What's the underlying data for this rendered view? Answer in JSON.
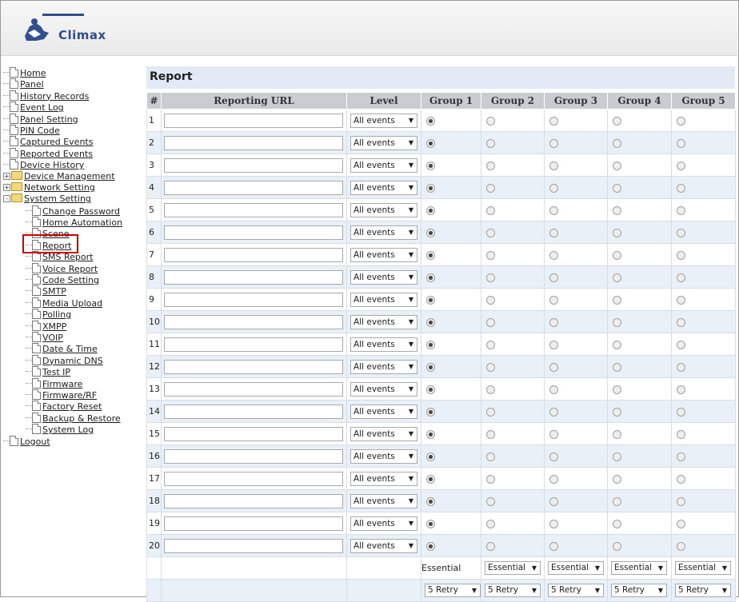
{
  "brand": {
    "name": "Climax"
  },
  "sidebar": {
    "items": [
      {
        "label": "Home",
        "kind": "doc",
        "level": 0
      },
      {
        "label": "Panel",
        "kind": "doc",
        "level": 0
      },
      {
        "label": "History Records",
        "kind": "doc",
        "level": 0
      },
      {
        "label": "Event Log",
        "kind": "doc",
        "level": 0
      },
      {
        "label": "Panel Setting",
        "kind": "doc",
        "level": 0
      },
      {
        "label": "PIN Code",
        "kind": "doc",
        "level": 0
      },
      {
        "label": "Captured Events",
        "kind": "doc",
        "level": 0
      },
      {
        "label": "Reported Events",
        "kind": "doc",
        "level": 0
      },
      {
        "label": "Device History",
        "kind": "doc",
        "level": 0
      },
      {
        "label": "Device Management",
        "kind": "folder",
        "level": 0,
        "expander": "+"
      },
      {
        "label": "Network Setting",
        "kind": "folder",
        "level": 0,
        "expander": "+"
      },
      {
        "label": "System Setting",
        "kind": "folder",
        "level": 0,
        "expander": "-"
      },
      {
        "label": "Change Password",
        "kind": "doc",
        "level": 1
      },
      {
        "label": "Home Automation",
        "kind": "doc",
        "level": 1
      },
      {
        "label": "Scene",
        "kind": "doc",
        "level": 1
      },
      {
        "label": "Report",
        "kind": "doc",
        "level": 1
      },
      {
        "label": "SMS Report",
        "kind": "doc",
        "level": 1
      },
      {
        "label": "Voice Report",
        "kind": "doc",
        "level": 1
      },
      {
        "label": "Code Setting",
        "kind": "doc",
        "level": 1
      },
      {
        "label": "SMTP",
        "kind": "doc",
        "level": 1
      },
      {
        "label": "Media Upload",
        "kind": "doc",
        "level": 1
      },
      {
        "label": "Polling",
        "kind": "doc",
        "level": 1
      },
      {
        "label": "XMPP",
        "kind": "doc",
        "level": 1
      },
      {
        "label": "VOIP",
        "kind": "doc",
        "level": 1
      },
      {
        "label": "Date & Time",
        "kind": "doc",
        "level": 1
      },
      {
        "label": "Dynamic DNS",
        "kind": "doc",
        "level": 1
      },
      {
        "label": "Test IP",
        "kind": "doc",
        "level": 1
      },
      {
        "label": "Firmware",
        "kind": "doc",
        "level": 1
      },
      {
        "label": "Firmware/RF",
        "kind": "doc",
        "level": 1
      },
      {
        "label": "Factory Reset",
        "kind": "doc",
        "level": 1
      },
      {
        "label": "Backup & Restore",
        "kind": "doc",
        "level": 1
      },
      {
        "label": "System Log",
        "kind": "doc",
        "level": 1
      },
      {
        "label": "Logout",
        "kind": "doc",
        "level": 0
      }
    ],
    "selected": "Report"
  },
  "main": {
    "title": "Report",
    "columns": [
      "#",
      "Reporting URL",
      "Level",
      "Group 1",
      "Group 2",
      "Group 3",
      "Group 4",
      "Group 5"
    ],
    "rows": [
      {
        "num": "1",
        "url": "",
        "level": "All events",
        "group": 1
      },
      {
        "num": "2",
        "url": "",
        "level": "All events",
        "group": 1
      },
      {
        "num": "3",
        "url": "",
        "level": "All events",
        "group": 1
      },
      {
        "num": "4",
        "url": "",
        "level": "All events",
        "group": 1
      },
      {
        "num": "5",
        "url": "",
        "level": "All events",
        "group": 1
      },
      {
        "num": "6",
        "url": "",
        "level": "All events",
        "group": 1
      },
      {
        "num": "7",
        "url": "",
        "level": "All events",
        "group": 1
      },
      {
        "num": "8",
        "url": "",
        "level": "All events",
        "group": 1
      },
      {
        "num": "9",
        "url": "",
        "level": "All events",
        "group": 1
      },
      {
        "num": "10",
        "url": "",
        "level": "All events",
        "group": 1
      },
      {
        "num": "11",
        "url": "",
        "level": "All events",
        "group": 1
      },
      {
        "num": "12",
        "url": "",
        "level": "All events",
        "group": 1
      },
      {
        "num": "13",
        "url": "",
        "level": "All events",
        "group": 1
      },
      {
        "num": "14",
        "url": "",
        "level": "All events",
        "group": 1
      },
      {
        "num": "15",
        "url": "",
        "level": "All events",
        "group": 1
      },
      {
        "num": "16",
        "url": "",
        "level": "All events",
        "group": 1
      },
      {
        "num": "17",
        "url": "",
        "level": "All events",
        "group": 1
      },
      {
        "num": "18",
        "url": "",
        "level": "All events",
        "group": 1
      },
      {
        "num": "19",
        "url": "",
        "level": "All events",
        "group": 1
      },
      {
        "num": "20",
        "url": "",
        "level": "All events",
        "group": 1
      }
    ],
    "footer": {
      "priority_label": "Essential",
      "priority": [
        "Essential",
        "Essential",
        "Essential",
        "Essential"
      ],
      "retry": [
        "5 Retry",
        "5 Retry",
        "5 Retry",
        "5 Retry",
        "5 Retry"
      ]
    }
  },
  "colors": {
    "header_bg": "#c9cdd2",
    "title_bg": "#e2ebf5",
    "alt_row": "#e9f0f7",
    "highlight": "#d10000"
  }
}
